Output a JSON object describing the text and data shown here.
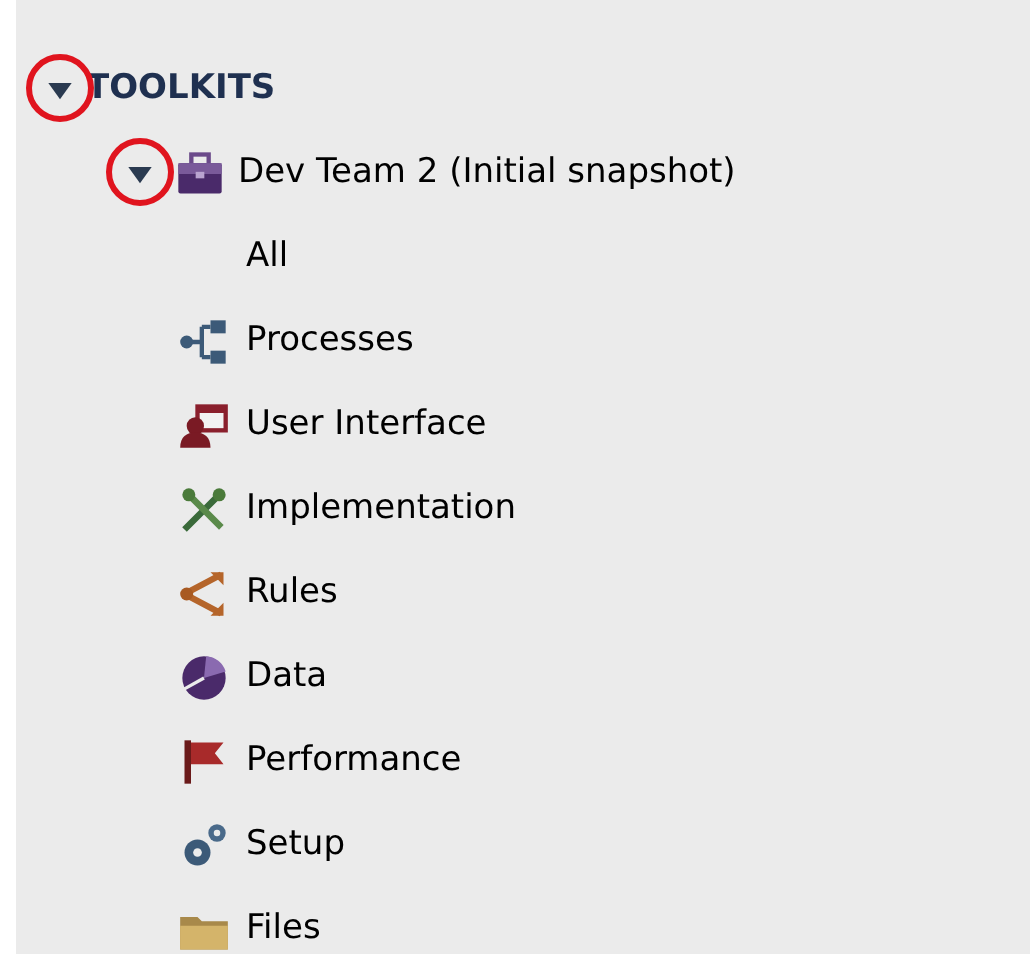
{
  "tree": [
    {
      "label": "TOOLKITS",
      "expanded": true,
      "highlighted": true,
      "children": [
        {
          "label": "Dev Team 2 (Initial snapshot)",
          "kind": "toolkit",
          "expanded": true,
          "highlighted": true,
          "children": [
            {
              "label": "All",
              "kind": "none"
            },
            {
              "label": "Processes",
              "kind": "processes"
            },
            {
              "label": "User Interface",
              "kind": "ui"
            },
            {
              "label": "Implementation",
              "kind": "tools"
            },
            {
              "label": "Rules",
              "kind": "rules"
            },
            {
              "label": "Data",
              "kind": "data"
            },
            {
              "label": "Performance",
              "kind": "flag"
            },
            {
              "label": "Setup",
              "kind": "gears"
            },
            {
              "label": "Files",
              "kind": "folder"
            }
          ]
        }
      ]
    }
  ]
}
